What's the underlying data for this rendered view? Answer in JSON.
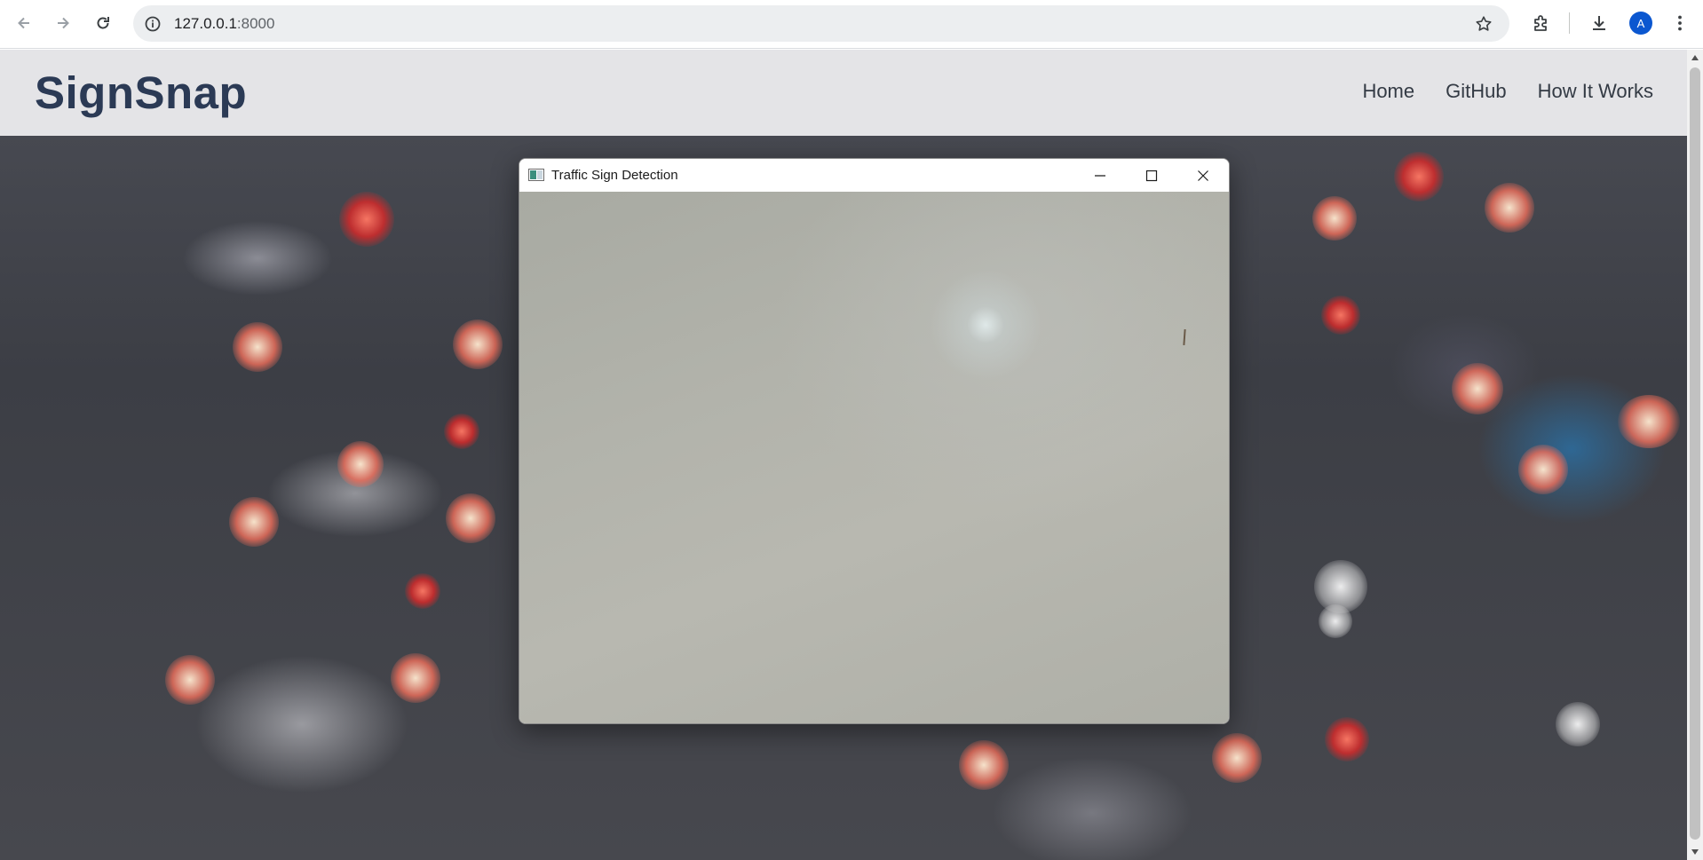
{
  "browser": {
    "url_host": "127.0.0.1",
    "url_port": ":8000",
    "profile_initial": "A",
    "icons": [
      "back-arrow-icon",
      "forward-arrow-icon",
      "reload-icon",
      "info-icon",
      "star-icon",
      "extensions-icon",
      "download-icon",
      "kebab-menu-icon"
    ]
  },
  "site": {
    "brand": "SignSnap",
    "nav": [
      {
        "label": "Home"
      },
      {
        "label": "GitHub"
      },
      {
        "label": "How It Works"
      }
    ],
    "colors": {
      "brand": "#2b3a55",
      "header_bg": "#f0f0f2"
    }
  },
  "window": {
    "title": "Traffic Sign Detection",
    "controls": [
      "minimize-icon",
      "maximize-icon",
      "close-icon"
    ]
  }
}
